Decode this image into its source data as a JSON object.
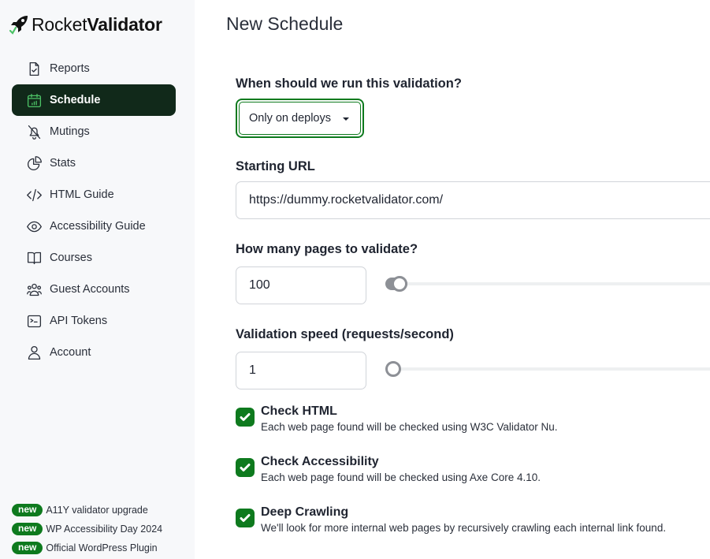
{
  "app": {
    "logo_light": "Rocket",
    "logo_bold": "Validator"
  },
  "sidebar": {
    "items": [
      {
        "label": "Reports",
        "icon": "file-check-icon",
        "active": false
      },
      {
        "label": "Schedule",
        "icon": "calendar-icon",
        "active": true
      },
      {
        "label": "Mutings",
        "icon": "bell-off-icon",
        "active": false
      },
      {
        "label": "Stats",
        "icon": "pie-chart-icon",
        "active": false
      },
      {
        "label": "HTML Guide",
        "icon": "code-icon",
        "active": false
      },
      {
        "label": "Accessibility Guide",
        "icon": "eye-icon",
        "active": false
      },
      {
        "label": "Courses",
        "icon": "book-icon",
        "active": false
      },
      {
        "label": "Guest Accounts",
        "icon": "users-icon",
        "active": false
      },
      {
        "label": "API Tokens",
        "icon": "terminal-icon",
        "active": false
      },
      {
        "label": "Account",
        "icon": "user-icon",
        "active": false
      }
    ],
    "news": [
      {
        "badge": "new",
        "text": "A11Y validator upgrade"
      },
      {
        "badge": "new",
        "text": "WP Accessibility Day 2024"
      },
      {
        "badge": "new",
        "text": "Official WordPress Plugin"
      }
    ]
  },
  "main": {
    "title": "New Schedule",
    "schedule": {
      "label": "When should we run this validation?",
      "selected": "Only on deploys"
    },
    "starting_url": {
      "label": "Starting URL",
      "value": "https://dummy.rocketvalidator.com/"
    },
    "pages": {
      "label": "How many pages to validate?",
      "value": "100",
      "slider_fraction": 0.02
    },
    "speed": {
      "label": "Validation speed (requests/second)",
      "value": "1",
      "slider_fraction": 0
    },
    "options": [
      {
        "title": "Check HTML",
        "description": "Each web page found will be checked using W3C Validator Nu.",
        "checked": true
      },
      {
        "title": "Check Accessibility",
        "description": "Each web page found will be checked using Axe Core 4.10.",
        "checked": true
      },
      {
        "title": "Deep Crawling",
        "description": "We'll look for more internal web pages by recursively crawling each internal link found.",
        "checked": true
      }
    ]
  },
  "colors": {
    "brand_green": "#0e7a1e",
    "active_nav_bg": "#11291a",
    "active_icon": "#4cc266",
    "slider_gray": "#8d9096"
  }
}
